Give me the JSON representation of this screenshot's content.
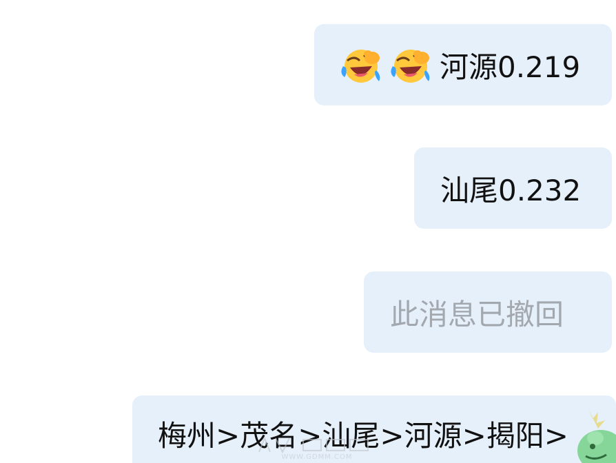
{
  "messages": [
    {
      "emoji": [
        "face-with-tears-of-joy-icon",
        "face-with-tears-of-joy-icon"
      ],
      "text": "河源0.219"
    },
    {
      "text": "汕尾0.232"
    },
    {
      "text": "此消息已撤回",
      "status": "recalled"
    },
    {
      "text": "梅州>茂名>汕尾>河源>揭阳>"
    }
  ],
  "watermark": {
    "url": "WWW.GDMM.COM"
  },
  "colors": {
    "bubble": "#e6f0fb",
    "text": "#111111",
    "recalled_text": "#a3a8ae"
  }
}
